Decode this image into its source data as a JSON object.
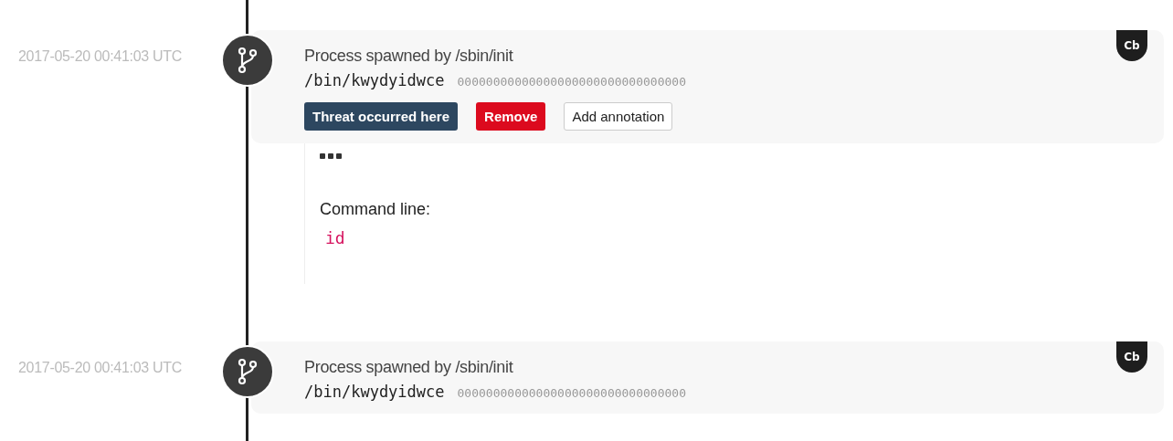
{
  "events": [
    {
      "timestamp": "2017-05-20 00:41:03 UTC",
      "title": "Process spawned by /sbin/init",
      "path": "/bin/kwydyidwce",
      "hash": "00000000000000000000000000000000",
      "badge": "Cb",
      "buttons": [
        {
          "label": "Threat occurred here",
          "kind": "threat"
        },
        {
          "label": "Remove",
          "kind": "danger"
        },
        {
          "label": "Add annotation",
          "kind": "default"
        }
      ],
      "details": {
        "label": "Command line:",
        "command": "id"
      }
    },
    {
      "timestamp": "2017-05-20 00:41:03 UTC",
      "title": "Process spawned by /sbin/init",
      "path": "/bin/kwydyidwce",
      "hash": "00000000000000000000000000000000",
      "badge": "Cb"
    }
  ]
}
